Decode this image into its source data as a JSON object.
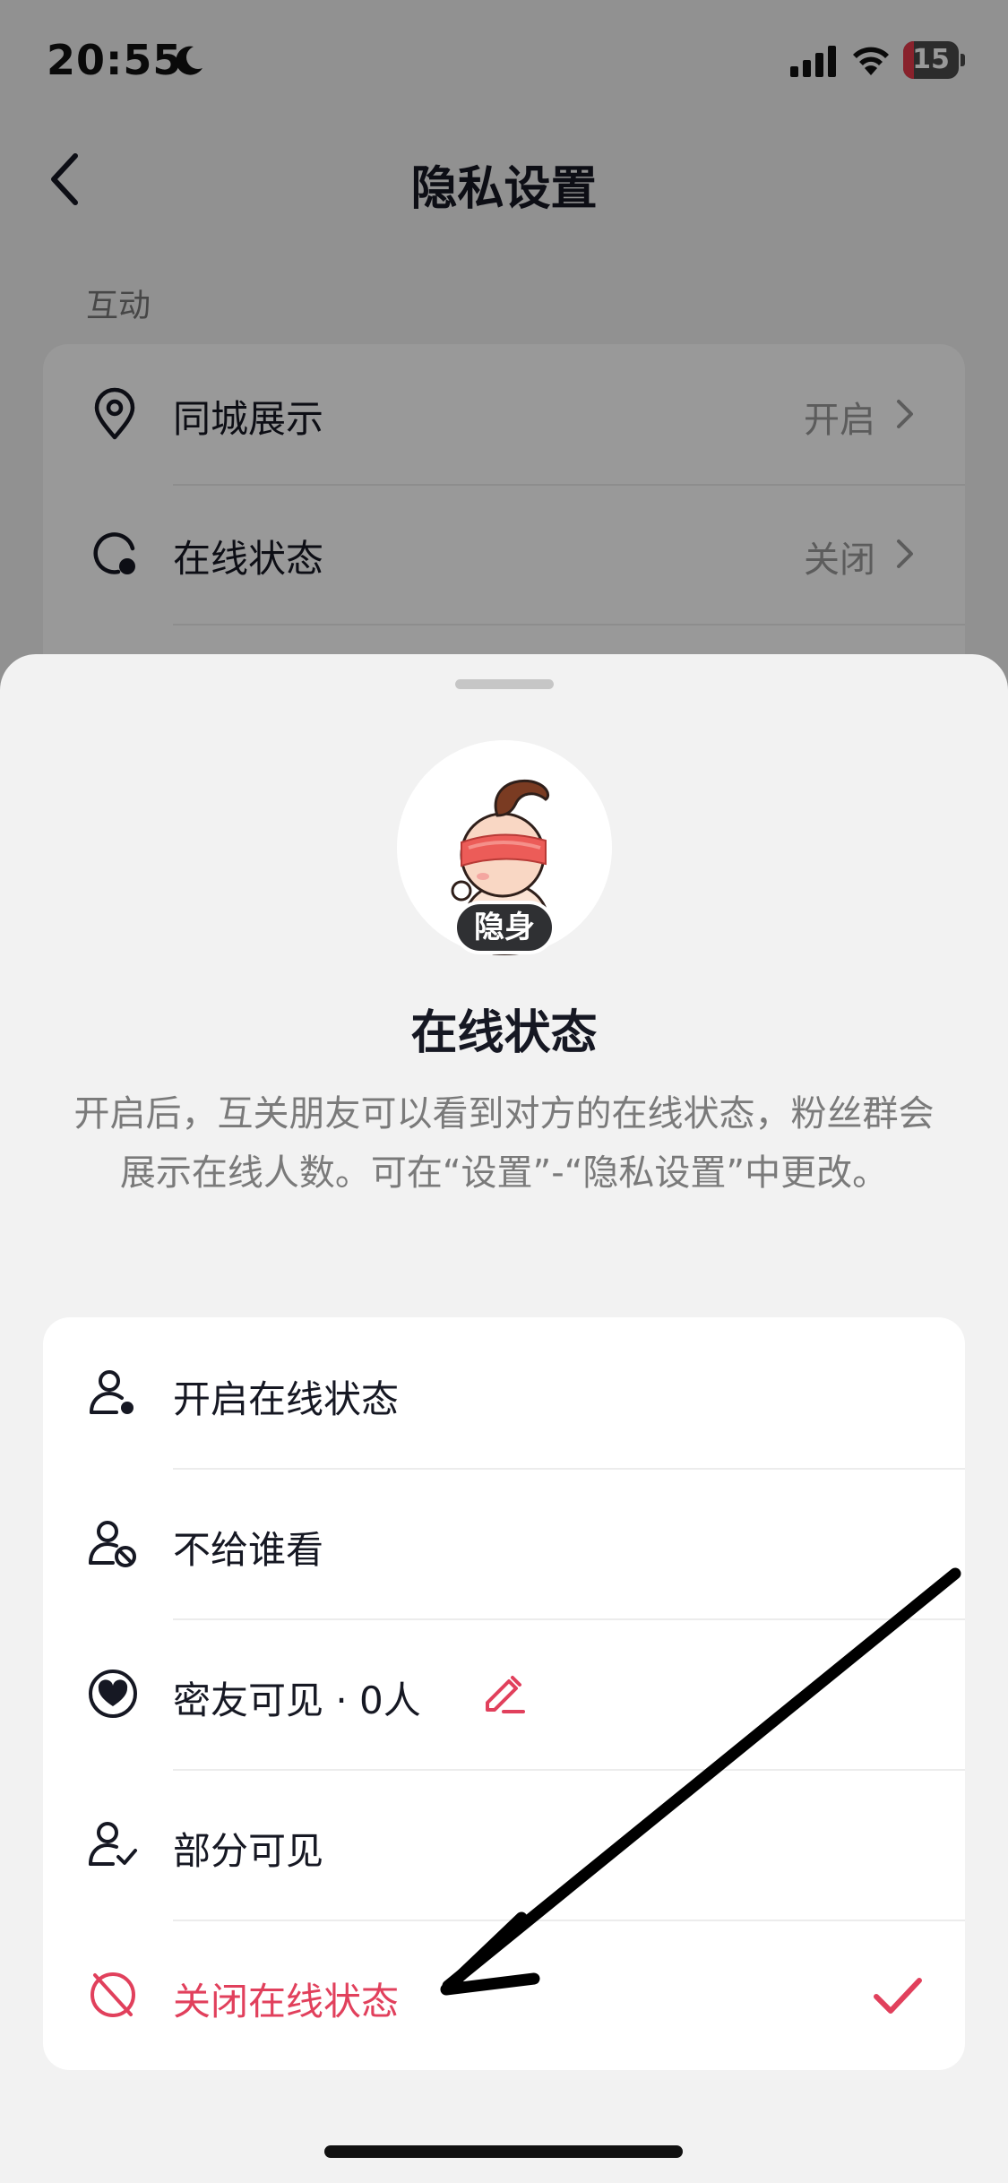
{
  "status_bar": {
    "time": "20:55",
    "battery": "15"
  },
  "nav": {
    "title": "隐私设置"
  },
  "section": {
    "label": "互动"
  },
  "background_rows": [
    {
      "label": "同城展示",
      "value": "开启"
    },
    {
      "label": "在线状态",
      "value": "关闭"
    }
  ],
  "sheet": {
    "avatar_badge": "隐身",
    "title": "在线状态",
    "description": "开启后，互关朋友可以看到对方的在线状态，粉丝群会展示在线人数。可在“设置”-“隐私设置”中更改。",
    "options": [
      {
        "label": "开启在线状态",
        "icon": "person-online-icon",
        "selected": false
      },
      {
        "label": "不给谁看",
        "icon": "person-blocked-icon",
        "selected": false
      },
      {
        "label": "密友可见 · 0人",
        "icon": "heart-circle-icon",
        "selected": false
      },
      {
        "label": "部分可见",
        "icon": "person-check-icon",
        "selected": false
      },
      {
        "label": "关闭在线状态",
        "icon": "online-off-icon",
        "selected": true
      }
    ]
  },
  "colors": {
    "accent": "#e1405c",
    "text_primary": "#161823",
    "text_secondary": "#7a7a7a",
    "sheet_background": "#f2f2f2"
  }
}
